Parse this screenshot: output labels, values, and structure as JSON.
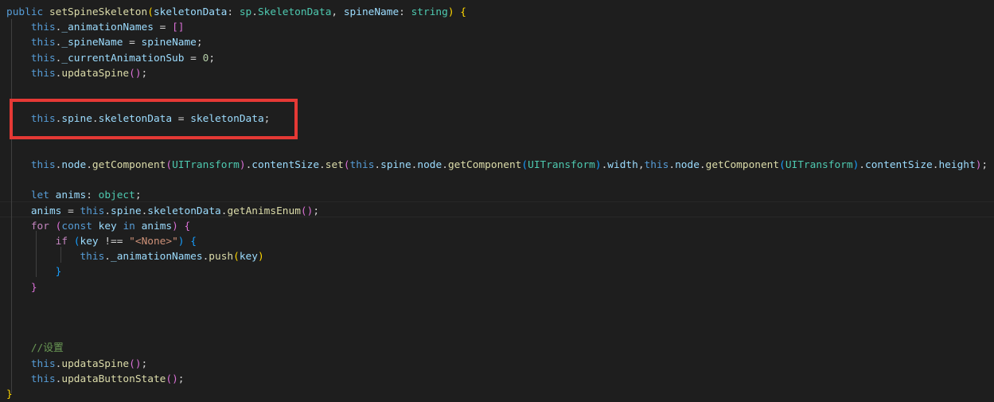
{
  "editor": {
    "language": "TypeScript",
    "lines": [
      [
        {
          "t": "public ",
          "c": "k-blue"
        },
        {
          "t": "setSpineSkeleton",
          "c": "fn"
        },
        {
          "t": "(",
          "c": "b1"
        },
        {
          "t": "skeletonData",
          "c": "var"
        },
        {
          "t": ": ",
          "c": "plain"
        },
        {
          "t": "sp",
          "c": "type"
        },
        {
          "t": ".",
          "c": "plain"
        },
        {
          "t": "SkeletonData",
          "c": "type"
        },
        {
          "t": ", ",
          "c": "plain"
        },
        {
          "t": "spineName",
          "c": "var"
        },
        {
          "t": ": ",
          "c": "plain"
        },
        {
          "t": "string",
          "c": "type"
        },
        {
          "t": ")",
          "c": "b1"
        },
        {
          "t": " ",
          "c": "plain"
        },
        {
          "t": "{",
          "c": "b1"
        }
      ],
      [
        {
          "t": "    ",
          "c": "plain"
        },
        {
          "t": "this",
          "c": "k-blue"
        },
        {
          "t": ".",
          "c": "plain"
        },
        {
          "t": "_animationNames",
          "c": "var"
        },
        {
          "t": " = ",
          "c": "plain"
        },
        {
          "t": "[]",
          "c": "b2"
        }
      ],
      [
        {
          "t": "    ",
          "c": "plain"
        },
        {
          "t": "this",
          "c": "k-blue"
        },
        {
          "t": ".",
          "c": "plain"
        },
        {
          "t": "_spineName",
          "c": "var"
        },
        {
          "t": " = ",
          "c": "plain"
        },
        {
          "t": "spineName",
          "c": "var"
        },
        {
          "t": ";",
          "c": "plain"
        }
      ],
      [
        {
          "t": "    ",
          "c": "plain"
        },
        {
          "t": "this",
          "c": "k-blue"
        },
        {
          "t": ".",
          "c": "plain"
        },
        {
          "t": "_currentAnimationSub",
          "c": "var"
        },
        {
          "t": " = ",
          "c": "plain"
        },
        {
          "t": "0",
          "c": "num"
        },
        {
          "t": ";",
          "c": "plain"
        }
      ],
      [
        {
          "t": "    ",
          "c": "plain"
        },
        {
          "t": "this",
          "c": "k-blue"
        },
        {
          "t": ".",
          "c": "plain"
        },
        {
          "t": "updataSpine",
          "c": "fn"
        },
        {
          "t": "()",
          "c": "b2"
        },
        {
          "t": ";",
          "c": "plain"
        }
      ],
      [],
      [],
      [
        {
          "t": "    ",
          "c": "plain"
        },
        {
          "t": "this",
          "c": "k-blue"
        },
        {
          "t": ".",
          "c": "plain"
        },
        {
          "t": "spine",
          "c": "var"
        },
        {
          "t": ".",
          "c": "plain"
        },
        {
          "t": "skeletonData",
          "c": "var"
        },
        {
          "t": " = ",
          "c": "plain"
        },
        {
          "t": "skeletonData",
          "c": "var"
        },
        {
          "t": ";",
          "c": "plain"
        }
      ],
      [],
      [],
      [
        {
          "t": "    ",
          "c": "plain"
        },
        {
          "t": "this",
          "c": "k-blue"
        },
        {
          "t": ".",
          "c": "plain"
        },
        {
          "t": "node",
          "c": "var"
        },
        {
          "t": ".",
          "c": "plain"
        },
        {
          "t": "getComponent",
          "c": "fn"
        },
        {
          "t": "(",
          "c": "b2"
        },
        {
          "t": "UITransform",
          "c": "type"
        },
        {
          "t": ")",
          "c": "b2"
        },
        {
          "t": ".",
          "c": "plain"
        },
        {
          "t": "contentSize",
          "c": "var"
        },
        {
          "t": ".",
          "c": "plain"
        },
        {
          "t": "set",
          "c": "fn"
        },
        {
          "t": "(",
          "c": "b2"
        },
        {
          "t": "this",
          "c": "k-blue"
        },
        {
          "t": ".",
          "c": "plain"
        },
        {
          "t": "spine",
          "c": "var"
        },
        {
          "t": ".",
          "c": "plain"
        },
        {
          "t": "node",
          "c": "var"
        },
        {
          "t": ".",
          "c": "plain"
        },
        {
          "t": "getComponent",
          "c": "fn"
        },
        {
          "t": "(",
          "c": "b3"
        },
        {
          "t": "UITransform",
          "c": "type"
        },
        {
          "t": ")",
          "c": "b3"
        },
        {
          "t": ".",
          "c": "plain"
        },
        {
          "t": "width",
          "c": "var"
        },
        {
          "t": ",",
          "c": "plain"
        },
        {
          "t": "this",
          "c": "k-blue"
        },
        {
          "t": ".",
          "c": "plain"
        },
        {
          "t": "node",
          "c": "var"
        },
        {
          "t": ".",
          "c": "plain"
        },
        {
          "t": "getComponent",
          "c": "fn"
        },
        {
          "t": "(",
          "c": "b3"
        },
        {
          "t": "UITransform",
          "c": "type"
        },
        {
          "t": ")",
          "c": "b3"
        },
        {
          "t": ".",
          "c": "plain"
        },
        {
          "t": "contentSize",
          "c": "var"
        },
        {
          "t": ".",
          "c": "plain"
        },
        {
          "t": "height",
          "c": "var"
        },
        {
          "t": ")",
          "c": "b2"
        },
        {
          "t": ";",
          "c": "plain"
        }
      ],
      [],
      [
        {
          "t": "    ",
          "c": "plain"
        },
        {
          "t": "let ",
          "c": "k-blue"
        },
        {
          "t": "anims",
          "c": "var"
        },
        {
          "t": ": ",
          "c": "plain"
        },
        {
          "t": "object",
          "c": "type"
        },
        {
          "t": ";",
          "c": "plain"
        }
      ],
      [
        {
          "t": "    ",
          "c": "plain"
        },
        {
          "t": "anims",
          "c": "var"
        },
        {
          "t": " = ",
          "c": "plain"
        },
        {
          "t": "this",
          "c": "k-blue"
        },
        {
          "t": ".",
          "c": "plain"
        },
        {
          "t": "spine",
          "c": "var"
        },
        {
          "t": ".",
          "c": "plain"
        },
        {
          "t": "skeletonData",
          "c": "var"
        },
        {
          "t": ".",
          "c": "plain"
        },
        {
          "t": "getAnimsEnum",
          "c": "fn"
        },
        {
          "t": "()",
          "c": "b2"
        },
        {
          "t": ";",
          "c": "plain"
        }
      ],
      [
        {
          "t": "    ",
          "c": "plain"
        },
        {
          "t": "for",
          "c": "k-purple"
        },
        {
          "t": " ",
          "c": "plain"
        },
        {
          "t": "(",
          "c": "b2"
        },
        {
          "t": "const ",
          "c": "k-blue"
        },
        {
          "t": "key",
          "c": "var"
        },
        {
          "t": " in ",
          "c": "k-blue"
        },
        {
          "t": "anims",
          "c": "var"
        },
        {
          "t": ")",
          "c": "b2"
        },
        {
          "t": " ",
          "c": "plain"
        },
        {
          "t": "{",
          "c": "b2"
        }
      ],
      [
        {
          "t": "        ",
          "c": "plain"
        },
        {
          "t": "if",
          "c": "k-purple"
        },
        {
          "t": " ",
          "c": "plain"
        },
        {
          "t": "(",
          "c": "b3"
        },
        {
          "t": "key",
          "c": "var"
        },
        {
          "t": " !== ",
          "c": "plain"
        },
        {
          "t": "\"<None>\"",
          "c": "str"
        },
        {
          "t": ")",
          "c": "b3"
        },
        {
          "t": " ",
          "c": "plain"
        },
        {
          "t": "{",
          "c": "b3"
        }
      ],
      [
        {
          "t": "            ",
          "c": "plain"
        },
        {
          "t": "this",
          "c": "k-blue"
        },
        {
          "t": ".",
          "c": "plain"
        },
        {
          "t": "_animationNames",
          "c": "var"
        },
        {
          "t": ".",
          "c": "plain"
        },
        {
          "t": "push",
          "c": "fn"
        },
        {
          "t": "(",
          "c": "b1"
        },
        {
          "t": "key",
          "c": "var"
        },
        {
          "t": ")",
          "c": "b1"
        }
      ],
      [
        {
          "t": "        ",
          "c": "plain"
        },
        {
          "t": "}",
          "c": "b3"
        }
      ],
      [
        {
          "t": "    ",
          "c": "plain"
        },
        {
          "t": "}",
          "c": "b2"
        }
      ],
      [],
      [],
      [],
      [
        {
          "t": "    ",
          "c": "plain"
        },
        {
          "t": "//设置",
          "c": "cmt"
        }
      ],
      [
        {
          "t": "    ",
          "c": "plain"
        },
        {
          "t": "this",
          "c": "k-blue"
        },
        {
          "t": ".",
          "c": "plain"
        },
        {
          "t": "updataSpine",
          "c": "fn"
        },
        {
          "t": "()",
          "c": "b2"
        },
        {
          "t": ";",
          "c": "plain"
        }
      ],
      [
        {
          "t": "    ",
          "c": "plain"
        },
        {
          "t": "this",
          "c": "k-blue"
        },
        {
          "t": ".",
          "c": "plain"
        },
        {
          "t": "updataButtonState",
          "c": "fn"
        },
        {
          "t": "()",
          "c": "b2"
        },
        {
          "t": ";",
          "c": "plain"
        }
      ],
      [
        {
          "t": "}",
          "c": "b1"
        }
      ]
    ]
  },
  "colors": {
    "background": "#1e1e1e",
    "highlight_box": "#e53935"
  }
}
